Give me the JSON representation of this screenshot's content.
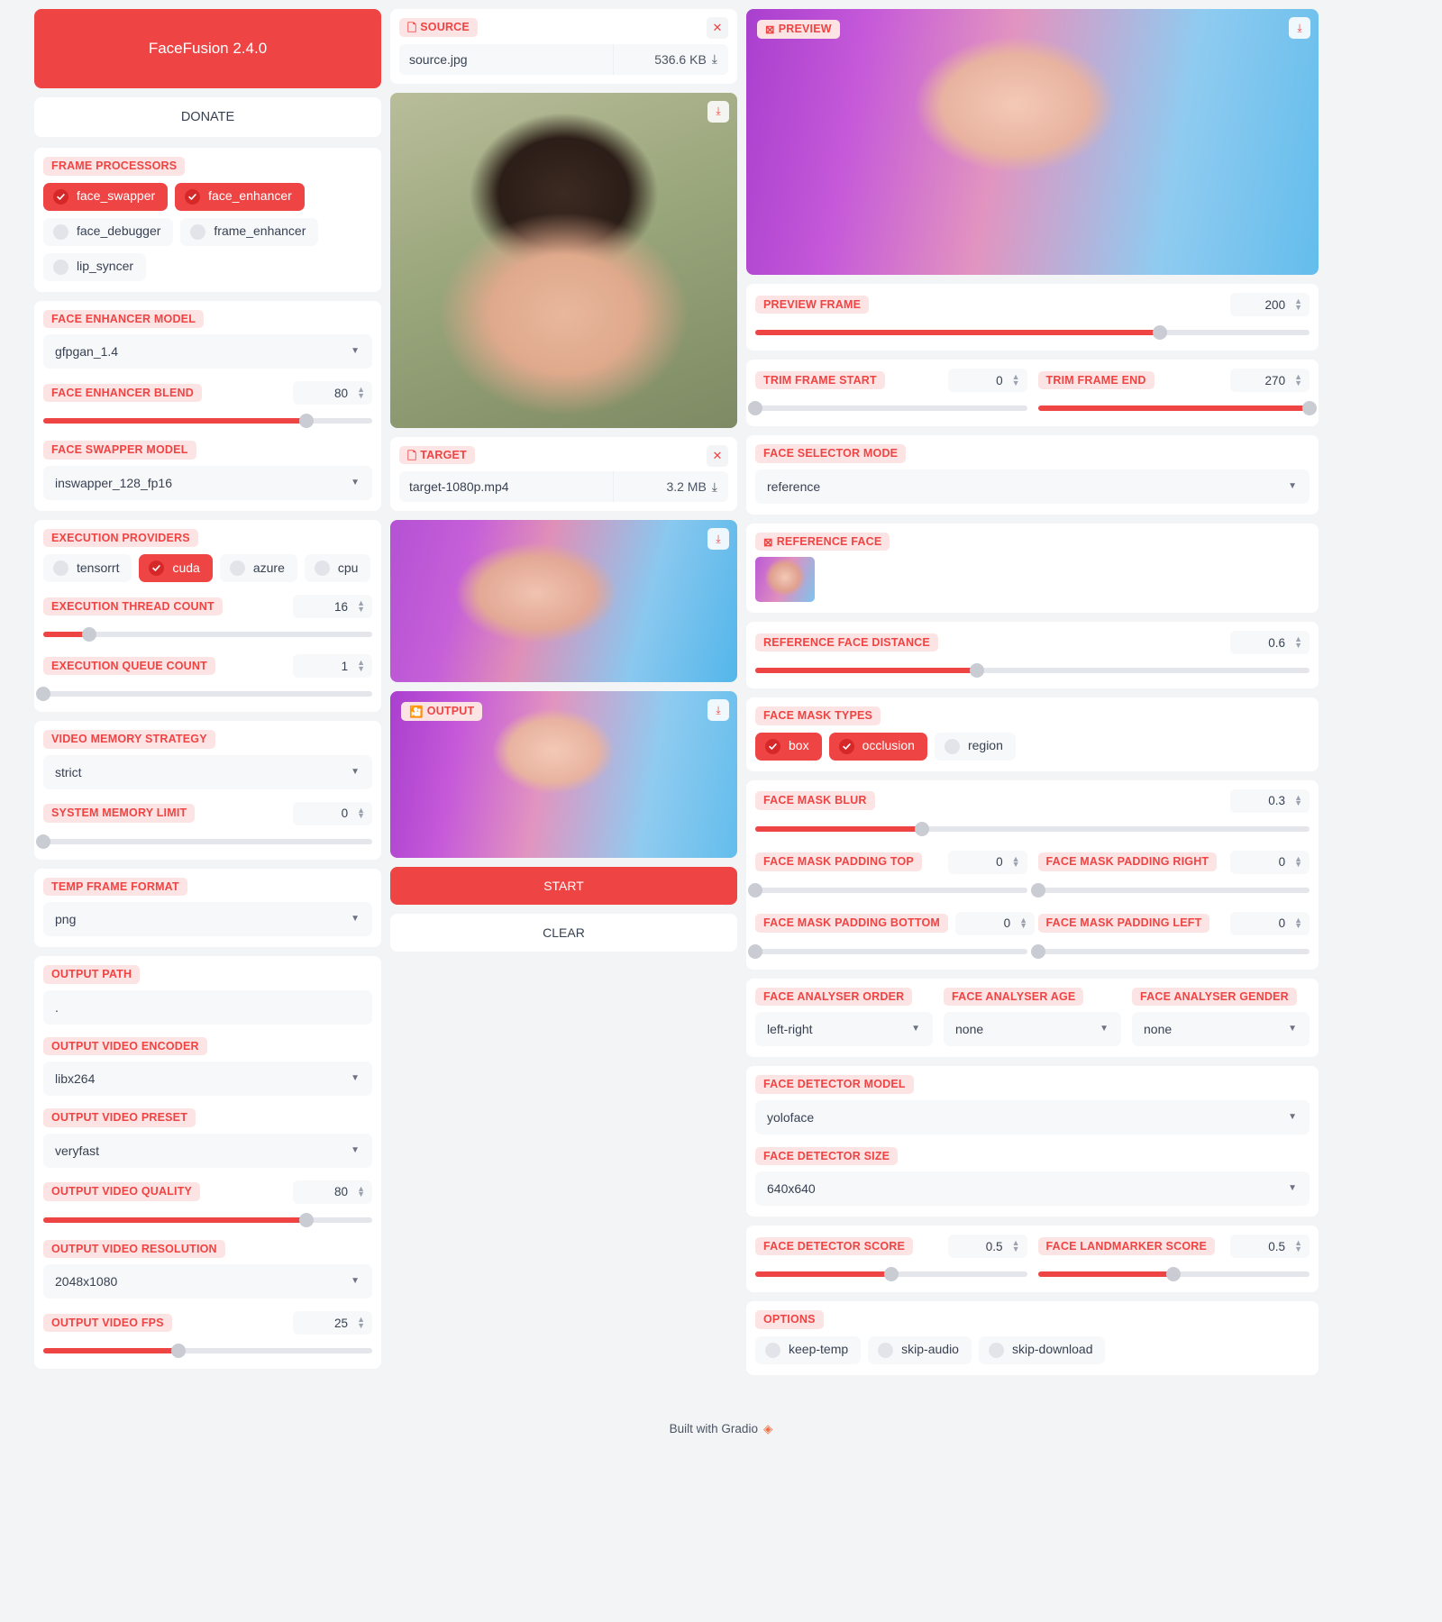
{
  "app": {
    "title": "FaceFusion 2.4.0",
    "donate_label": "DONATE",
    "accent": "#ef4444",
    "label_bg": "#fde4e4"
  },
  "footer": {
    "text": "Built with Gradio",
    "logo_icon": "gradio-logo-icon"
  },
  "frame_processors": {
    "label": "FRAME PROCESSORS",
    "items": [
      {
        "label": "face_swapper",
        "checked": true
      },
      {
        "label": "face_enhancer",
        "checked": true
      },
      {
        "label": "face_debugger",
        "checked": false
      },
      {
        "label": "frame_enhancer",
        "checked": false
      },
      {
        "label": "lip_syncer",
        "checked": false
      }
    ]
  },
  "face_enhancer_model": {
    "label": "FACE ENHANCER MODEL",
    "value": "gfpgan_1.4"
  },
  "face_enhancer_blend": {
    "label": "FACE ENHANCER BLEND",
    "value": "80",
    "percent": 80
  },
  "face_swapper_model": {
    "label": "FACE SWAPPER MODEL",
    "value": "inswapper_128_fp16"
  },
  "execution_providers": {
    "label": "EXECUTION PROVIDERS",
    "items": [
      {
        "label": "tensorrt",
        "checked": false
      },
      {
        "label": "cuda",
        "checked": true
      },
      {
        "label": "azure",
        "checked": false
      },
      {
        "label": "cpu",
        "checked": false
      }
    ]
  },
  "execution_thread_count": {
    "label": "EXECUTION THREAD COUNT",
    "value": "16",
    "percent": 14
  },
  "execution_queue_count": {
    "label": "EXECUTION QUEUE COUNT",
    "value": "1",
    "percent": 0
  },
  "video_memory_strategy": {
    "label": "VIDEO MEMORY STRATEGY",
    "value": "strict"
  },
  "system_memory_limit": {
    "label": "SYSTEM MEMORY LIMIT",
    "value": "0",
    "percent": 0
  },
  "temp_frame_format": {
    "label": "TEMP FRAME FORMAT",
    "value": "png"
  },
  "output_path": {
    "label": "OUTPUT PATH",
    "value": "."
  },
  "output_video_encoder": {
    "label": "OUTPUT VIDEO ENCODER",
    "value": "libx264"
  },
  "output_video_preset": {
    "label": "OUTPUT VIDEO PRESET",
    "value": "veryfast"
  },
  "output_video_quality": {
    "label": "OUTPUT VIDEO QUALITY",
    "value": "80",
    "percent": 80
  },
  "output_video_resolution": {
    "label": "OUTPUT VIDEO RESOLUTION",
    "value": "2048x1080"
  },
  "output_video_fps": {
    "label": "OUTPUT VIDEO FPS",
    "value": "25",
    "percent": 41
  },
  "source": {
    "label": "SOURCE",
    "icon": "file-icon",
    "file_name": "source.jpg",
    "file_size": "536.6 KB",
    "download_icon": "download-icon",
    "close_icon": "close-icon"
  },
  "target": {
    "label": "TARGET",
    "icon": "file-icon",
    "file_name": "target-1080p.mp4",
    "file_size": "3.2 MB",
    "download_icon": "download-icon",
    "close_icon": "close-icon"
  },
  "output": {
    "label": "OUTPUT",
    "icon": "video-icon",
    "download_icon": "download-icon"
  },
  "actions": {
    "start_label": "START",
    "clear_label": "CLEAR"
  },
  "preview": {
    "label": "PREVIEW",
    "icon": "image-icon",
    "download_icon": "download-icon"
  },
  "preview_frame": {
    "label": "PREVIEW FRAME",
    "value": "200",
    "percent": 73
  },
  "trim_frame_start": {
    "label": "TRIM FRAME START",
    "value": "0",
    "percent": 0
  },
  "trim_frame_end": {
    "label": "TRIM FRAME END",
    "value": "270",
    "percent": 100
  },
  "face_selector_mode": {
    "label": "FACE SELECTOR MODE",
    "value": "reference"
  },
  "reference_face": {
    "label": "REFERENCE FACE",
    "icon": "image-icon"
  },
  "reference_face_distance": {
    "label": "REFERENCE FACE DISTANCE",
    "value": "0.6",
    "percent": 40
  },
  "face_mask_types": {
    "label": "FACE MASK TYPES",
    "items": [
      {
        "label": "box",
        "checked": true
      },
      {
        "label": "occlusion",
        "checked": true
      },
      {
        "label": "region",
        "checked": false
      }
    ]
  },
  "face_mask_blur": {
    "label": "FACE MASK BLUR",
    "value": "0.3",
    "percent": 30
  },
  "face_mask_padding_top": {
    "label": "FACE MASK PADDING TOP",
    "value": "0",
    "percent": 0
  },
  "face_mask_padding_right": {
    "label": "FACE MASK PADDING RIGHT",
    "value": "0",
    "percent": 0
  },
  "face_mask_padding_bottom": {
    "label": "FACE MASK PADDING BOTTOM",
    "value": "0",
    "percent": 0
  },
  "face_mask_padding_left": {
    "label": "FACE MASK PADDING LEFT",
    "value": "0",
    "percent": 0
  },
  "face_analyser_order": {
    "label": "FACE ANALYSER ORDER",
    "value": "left-right"
  },
  "face_analyser_age": {
    "label": "FACE ANALYSER AGE",
    "value": "none"
  },
  "face_analyser_gender": {
    "label": "FACE ANALYSER GENDER",
    "value": "none"
  },
  "face_detector_model": {
    "label": "FACE DETECTOR MODEL",
    "value": "yoloface"
  },
  "face_detector_size": {
    "label": "FACE DETECTOR SIZE",
    "value": "640x640"
  },
  "face_detector_score": {
    "label": "FACE DETECTOR SCORE",
    "value": "0.5",
    "percent": 50
  },
  "face_landmarker_score": {
    "label": "FACE LANDMARKER SCORE",
    "value": "0.5",
    "percent": 50
  },
  "options": {
    "label": "OPTIONS",
    "items": [
      {
        "label": "keep-temp",
        "checked": false
      },
      {
        "label": "skip-audio",
        "checked": false
      },
      {
        "label": "skip-download",
        "checked": false
      }
    ]
  }
}
